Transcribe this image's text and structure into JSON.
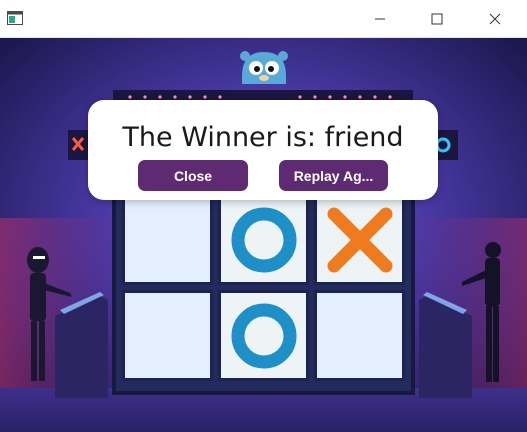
{
  "window": {
    "controls": [
      {
        "name": "minimize-icon"
      },
      {
        "name": "maximize-icon"
      },
      {
        "name": "close-icon"
      }
    ]
  },
  "dialog": {
    "message": "The Winner is: friend",
    "close_label": "Close",
    "replay_label": "Replay Ag..."
  },
  "board": {
    "rows": [
      [
        "",
        "O",
        "X"
      ],
      [
        "",
        "O",
        ""
      ]
    ]
  },
  "colors": {
    "o_mark": "#1f8fc7",
    "x_mark": "#f07a1e",
    "button": "#5e2a72",
    "cell_empty": "#e3efff"
  }
}
